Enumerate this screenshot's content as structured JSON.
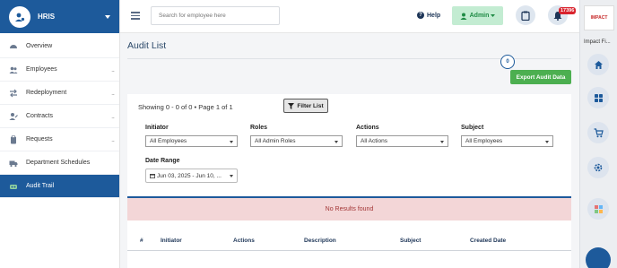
{
  "brand": {
    "title": "HRIS"
  },
  "sidebar": {
    "items": [
      {
        "label": "Overview",
        "icon": "dashboard-icon",
        "has_more": false
      },
      {
        "label": "Employees",
        "icon": "users-icon",
        "has_more": true
      },
      {
        "label": "Redeployment",
        "icon": "swap-icon",
        "has_more": true
      },
      {
        "label": "Contracts",
        "icon": "user-edit-icon",
        "has_more": true
      },
      {
        "label": "Requests",
        "icon": "clipboard-icon",
        "has_more": true
      },
      {
        "label": "Department Schedules",
        "icon": "truck-icon",
        "has_more": false
      },
      {
        "label": "Audit Trail",
        "icon": "trail-icon",
        "has_more": false,
        "active": true
      }
    ],
    "more_glyph": "..."
  },
  "topbar": {
    "search_placeholder": "Search for employee here",
    "help_label": "Help",
    "admin_label": "Admin",
    "notification_count": "17396"
  },
  "rail": {
    "logo_text": "IMPACT",
    "label": "Impact Fi..."
  },
  "page": {
    "title": "Audit List",
    "counter": "0",
    "export_label": "Export Audit Data",
    "showing_text": "Showing 0 - 0 of 0 • Page 1 of 1",
    "filter_label": "Filter List"
  },
  "filters": {
    "initiator": {
      "label": "Initiator",
      "value": "All Employees"
    },
    "roles": {
      "label": "Roles",
      "value": "All Admin Roles"
    },
    "actions": {
      "label": "Actions",
      "value": "All Actions"
    },
    "subject": {
      "label": "Subject",
      "value": "All Employees"
    },
    "date_range": {
      "label": "Date Range",
      "value": "Jun 03, 2025 - Jun 10, ..."
    }
  },
  "table": {
    "no_results": "No Results found",
    "columns": [
      "#",
      "Initiator",
      "Actions",
      "Description",
      "Subject",
      "Created Date"
    ]
  },
  "colors": {
    "brand": "#1d5a9b",
    "export": "#4caf50",
    "badge": "#d9232d",
    "no_results_bg": "#f3d6d7"
  }
}
